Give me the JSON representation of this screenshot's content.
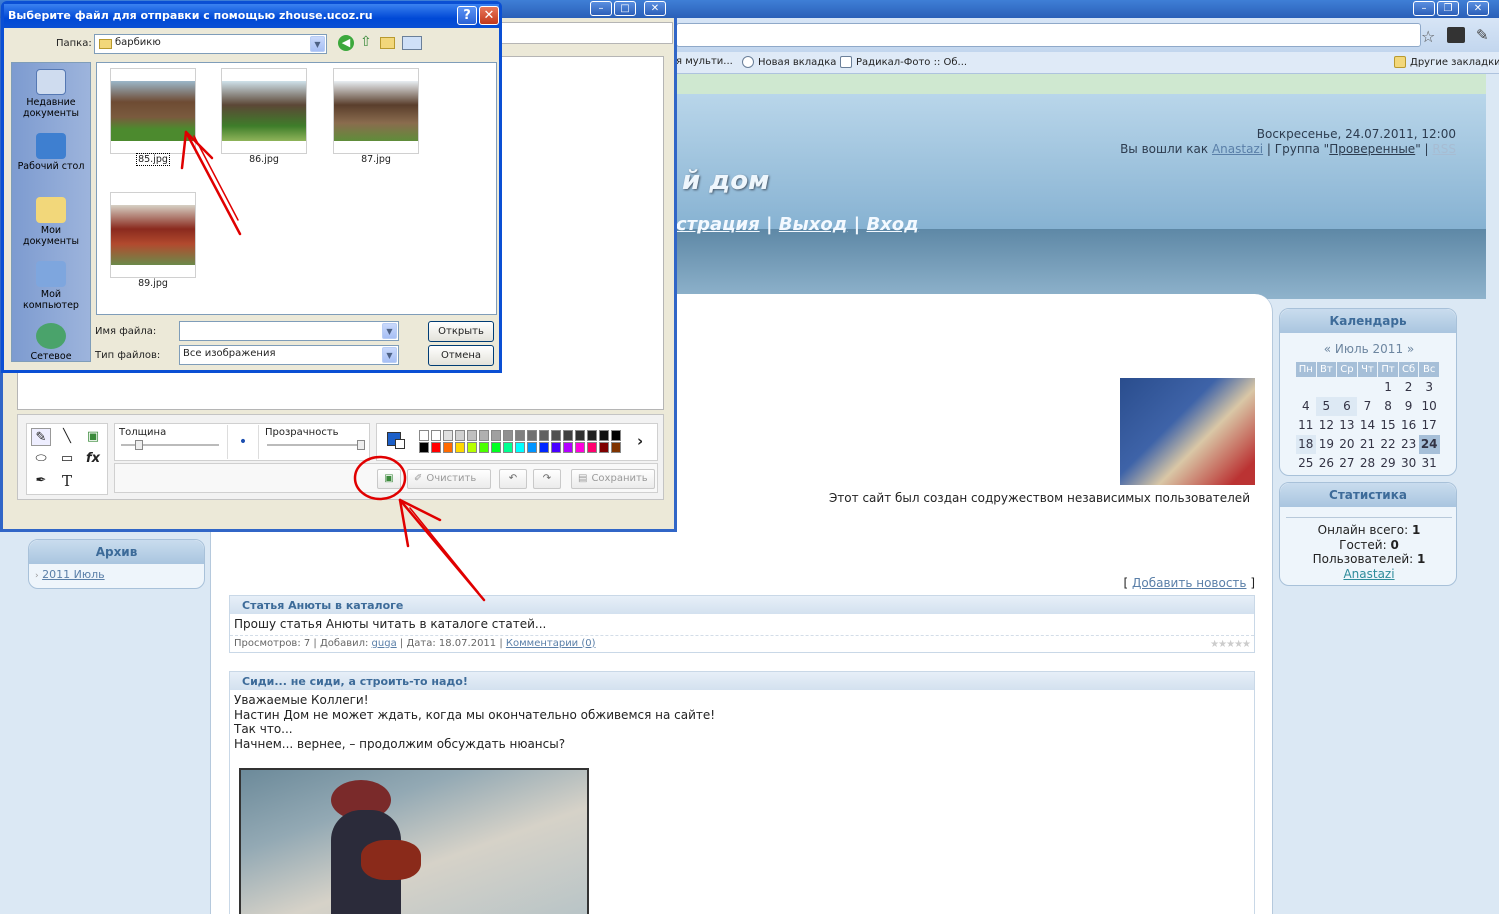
{
  "browser": {
    "bookmarks": [
      "я мульти...",
      "Новая вкладка",
      "Радикал-Фото :: Об..."
    ],
    "other_bookmarks": "Другие закладки"
  },
  "site": {
    "date_line": "Воскресенье, 24.07.2011, 12:00",
    "login_prefix": "Вы вошли как",
    "login_user": "Anastazi",
    "group_prefix": "| Группа \"",
    "group_name": "Проверенные",
    "group_suffix": "\" |",
    "rss": "RSS",
    "title_fragment": "й дом",
    "nav": {
      "reg_fragment": "страция",
      "sep": "|",
      "logout": "Выход",
      "login": "Вход"
    },
    "credit": "Этот сайт был создан содружеством независимых пользователей",
    "add_news_open": "[",
    "add_news": "Добавить новость",
    "add_news_close": "]"
  },
  "news": [
    {
      "title": "Статья Анюты в каталоге",
      "body": [
        "Прошу статья Анюты читать в каталоге статей..."
      ],
      "meta_views": "Просмотров: 7 | Добавил:",
      "meta_author": "guga",
      "meta_date": "| Дата: 18.07.2011 |",
      "meta_comments": "Комментарии (0)",
      "rating": "★★★★★"
    },
    {
      "title": "Сиди... не сиди, а строить-то надо!",
      "body": [
        "Уважаемые Коллеги!",
        "Настин Дом не может ждать, когда мы окончательно обживемся на сайте!",
        "Так что...",
        "Начнем... вернее, – продолжим обсуждать нюансы?"
      ]
    }
  ],
  "calendar": {
    "title": "Календарь",
    "month": "«   Июль 2011   »",
    "weekdays": [
      "Пн",
      "Вт",
      "Ср",
      "Чт",
      "Пт",
      "Сб",
      "Вс"
    ],
    "weeks": [
      [
        "",
        "",
        "",
        "",
        "1",
        "2",
        "3"
      ],
      [
        "4",
        "5",
        "6",
        "7",
        "8",
        "9",
        "10"
      ],
      [
        "11",
        "12",
        "13",
        "14",
        "15",
        "16",
        "17"
      ],
      [
        "18",
        "19",
        "20",
        "21",
        "22",
        "23",
        "24"
      ],
      [
        "25",
        "26",
        "27",
        "28",
        "29",
        "30",
        "31"
      ]
    ]
  },
  "stats": {
    "title": "Статистика",
    "online_label": "Онлайн всего:",
    "online": "1",
    "guests_label": "Гостей:",
    "guests": "0",
    "users_label": "Пользователей:",
    "users": "1",
    "user_link": "Anastazi"
  },
  "archive": {
    "title": "Архив",
    "item": "2011 Июль"
  },
  "editor": {
    "thickness": "Толщина",
    "opacity": "Прозрачность",
    "clear": "Очистить",
    "save": "Сохранить",
    "fx": "fx",
    "text_tool": "T"
  },
  "palette": [
    "#ffffff",
    "#ffffff",
    "#e0e0e0",
    "#d0d0d0",
    "#c0c0c0",
    "#b0b0b0",
    "#a0a0a0",
    "#909090",
    "#808080",
    "#707070",
    "#606060",
    "#505050",
    "#404040",
    "#303030",
    "#202020",
    "#101010",
    "#000000",
    "#000000",
    "#ff0000",
    "#ff6a00",
    "#ffd800",
    "#b6ff00",
    "#4cff00",
    "#00ff21",
    "#00ff90",
    "#00ffff",
    "#0094ff",
    "#0026ff",
    "#4800ff",
    "#b200ff",
    "#ff00dc",
    "#ff006e",
    "#7f0000",
    "#7f3300"
  ],
  "dialog": {
    "title": "Выберите файл для отправки с помощью zhouse.ucoz.ru",
    "help": "?",
    "close": "✕",
    "folder_label": "Папка:",
    "folder": "барбикю",
    "places": [
      "Недавние документы",
      "Рабочий стол",
      "Мои документы",
      "Мой компьютер",
      "Сетевое"
    ],
    "files": [
      "85.jpg",
      "86.jpg",
      "87.jpg",
      "89.jpg"
    ],
    "filename_label": "Имя файла:",
    "filename": "",
    "filetype_label": "Тип файлов:",
    "filetype": "Все изображения",
    "open": "Открыть",
    "cancel": "Отмена"
  },
  "colors": {
    "xp_blue": "#0a4fd4",
    "link": "#5a7fa8",
    "annotation": "#e00000"
  }
}
